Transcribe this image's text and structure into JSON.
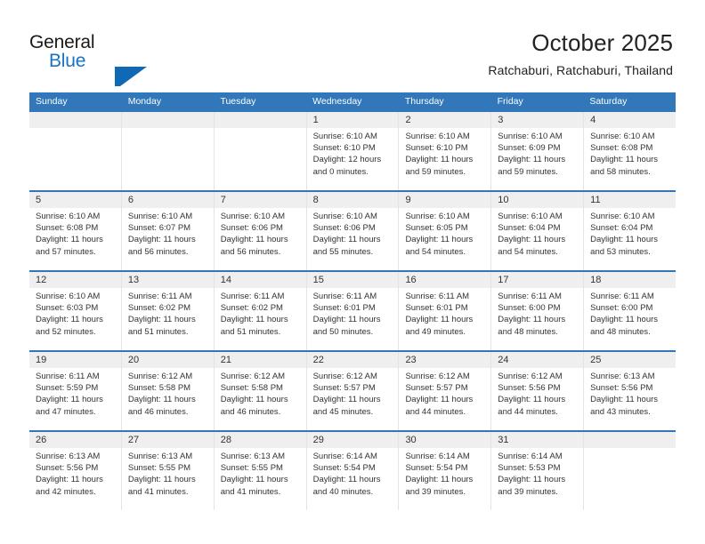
{
  "brand": {
    "name_part1": "General",
    "name_part2": "Blue",
    "accent_color": "#1069b4"
  },
  "header": {
    "title": "October 2025",
    "subtitle": "Ratchaburi, Ratchaburi, Thailand"
  },
  "theme": {
    "header_blue": "#3277b9",
    "day_band_gray": "#efefef",
    "text": "#333333"
  },
  "weekdays": [
    "Sunday",
    "Monday",
    "Tuesday",
    "Wednesday",
    "Thursday",
    "Friday",
    "Saturday"
  ],
  "labels": {
    "sunrise_prefix": "Sunrise:",
    "sunset_prefix": "Sunset:",
    "daylight_prefix": "Daylight:"
  },
  "weeks": [
    [
      {
        "day": "",
        "empty": true
      },
      {
        "day": "",
        "empty": true
      },
      {
        "day": "",
        "empty": true
      },
      {
        "day": "1",
        "sunrise": "Sunrise: 6:10 AM",
        "sunset": "Sunset: 6:10 PM",
        "daylight": "Daylight: 12 hours and 0 minutes."
      },
      {
        "day": "2",
        "sunrise": "Sunrise: 6:10 AM",
        "sunset": "Sunset: 6:10 PM",
        "daylight": "Daylight: 11 hours and 59 minutes."
      },
      {
        "day": "3",
        "sunrise": "Sunrise: 6:10 AM",
        "sunset": "Sunset: 6:09 PM",
        "daylight": "Daylight: 11 hours and 59 minutes."
      },
      {
        "day": "4",
        "sunrise": "Sunrise: 6:10 AM",
        "sunset": "Sunset: 6:08 PM",
        "daylight": "Daylight: 11 hours and 58 minutes."
      }
    ],
    [
      {
        "day": "5",
        "sunrise": "Sunrise: 6:10 AM",
        "sunset": "Sunset: 6:08 PM",
        "daylight": "Daylight: 11 hours and 57 minutes."
      },
      {
        "day": "6",
        "sunrise": "Sunrise: 6:10 AM",
        "sunset": "Sunset: 6:07 PM",
        "daylight": "Daylight: 11 hours and 56 minutes."
      },
      {
        "day": "7",
        "sunrise": "Sunrise: 6:10 AM",
        "sunset": "Sunset: 6:06 PM",
        "daylight": "Daylight: 11 hours and 56 minutes."
      },
      {
        "day": "8",
        "sunrise": "Sunrise: 6:10 AM",
        "sunset": "Sunset: 6:06 PM",
        "daylight": "Daylight: 11 hours and 55 minutes."
      },
      {
        "day": "9",
        "sunrise": "Sunrise: 6:10 AM",
        "sunset": "Sunset: 6:05 PM",
        "daylight": "Daylight: 11 hours and 54 minutes."
      },
      {
        "day": "10",
        "sunrise": "Sunrise: 6:10 AM",
        "sunset": "Sunset: 6:04 PM",
        "daylight": "Daylight: 11 hours and 54 minutes."
      },
      {
        "day": "11",
        "sunrise": "Sunrise: 6:10 AM",
        "sunset": "Sunset: 6:04 PM",
        "daylight": "Daylight: 11 hours and 53 minutes."
      }
    ],
    [
      {
        "day": "12",
        "sunrise": "Sunrise: 6:10 AM",
        "sunset": "Sunset: 6:03 PM",
        "daylight": "Daylight: 11 hours and 52 minutes."
      },
      {
        "day": "13",
        "sunrise": "Sunrise: 6:11 AM",
        "sunset": "Sunset: 6:02 PM",
        "daylight": "Daylight: 11 hours and 51 minutes."
      },
      {
        "day": "14",
        "sunrise": "Sunrise: 6:11 AM",
        "sunset": "Sunset: 6:02 PM",
        "daylight": "Daylight: 11 hours and 51 minutes."
      },
      {
        "day": "15",
        "sunrise": "Sunrise: 6:11 AM",
        "sunset": "Sunset: 6:01 PM",
        "daylight": "Daylight: 11 hours and 50 minutes."
      },
      {
        "day": "16",
        "sunrise": "Sunrise: 6:11 AM",
        "sunset": "Sunset: 6:01 PM",
        "daylight": "Daylight: 11 hours and 49 minutes."
      },
      {
        "day": "17",
        "sunrise": "Sunrise: 6:11 AM",
        "sunset": "Sunset: 6:00 PM",
        "daylight": "Daylight: 11 hours and 48 minutes."
      },
      {
        "day": "18",
        "sunrise": "Sunrise: 6:11 AM",
        "sunset": "Sunset: 6:00 PM",
        "daylight": "Daylight: 11 hours and 48 minutes."
      }
    ],
    [
      {
        "day": "19",
        "sunrise": "Sunrise: 6:11 AM",
        "sunset": "Sunset: 5:59 PM",
        "daylight": "Daylight: 11 hours and 47 minutes."
      },
      {
        "day": "20",
        "sunrise": "Sunrise: 6:12 AM",
        "sunset": "Sunset: 5:58 PM",
        "daylight": "Daylight: 11 hours and 46 minutes."
      },
      {
        "day": "21",
        "sunrise": "Sunrise: 6:12 AM",
        "sunset": "Sunset: 5:58 PM",
        "daylight": "Daylight: 11 hours and 46 minutes."
      },
      {
        "day": "22",
        "sunrise": "Sunrise: 6:12 AM",
        "sunset": "Sunset: 5:57 PM",
        "daylight": "Daylight: 11 hours and 45 minutes."
      },
      {
        "day": "23",
        "sunrise": "Sunrise: 6:12 AM",
        "sunset": "Sunset: 5:57 PM",
        "daylight": "Daylight: 11 hours and 44 minutes."
      },
      {
        "day": "24",
        "sunrise": "Sunrise: 6:12 AM",
        "sunset": "Sunset: 5:56 PM",
        "daylight": "Daylight: 11 hours and 44 minutes."
      },
      {
        "day": "25",
        "sunrise": "Sunrise: 6:13 AM",
        "sunset": "Sunset: 5:56 PM",
        "daylight": "Daylight: 11 hours and 43 minutes."
      }
    ],
    [
      {
        "day": "26",
        "sunrise": "Sunrise: 6:13 AM",
        "sunset": "Sunset: 5:56 PM",
        "daylight": "Daylight: 11 hours and 42 minutes."
      },
      {
        "day": "27",
        "sunrise": "Sunrise: 6:13 AM",
        "sunset": "Sunset: 5:55 PM",
        "daylight": "Daylight: 11 hours and 41 minutes."
      },
      {
        "day": "28",
        "sunrise": "Sunrise: 6:13 AM",
        "sunset": "Sunset: 5:55 PM",
        "daylight": "Daylight: 11 hours and 41 minutes."
      },
      {
        "day": "29",
        "sunrise": "Sunrise: 6:14 AM",
        "sunset": "Sunset: 5:54 PM",
        "daylight": "Daylight: 11 hours and 40 minutes."
      },
      {
        "day": "30",
        "sunrise": "Sunrise: 6:14 AM",
        "sunset": "Sunset: 5:54 PM",
        "daylight": "Daylight: 11 hours and 39 minutes."
      },
      {
        "day": "31",
        "sunrise": "Sunrise: 6:14 AM",
        "sunset": "Sunset: 5:53 PM",
        "daylight": "Daylight: 11 hours and 39 minutes."
      },
      {
        "day": "",
        "empty": true
      }
    ]
  ]
}
